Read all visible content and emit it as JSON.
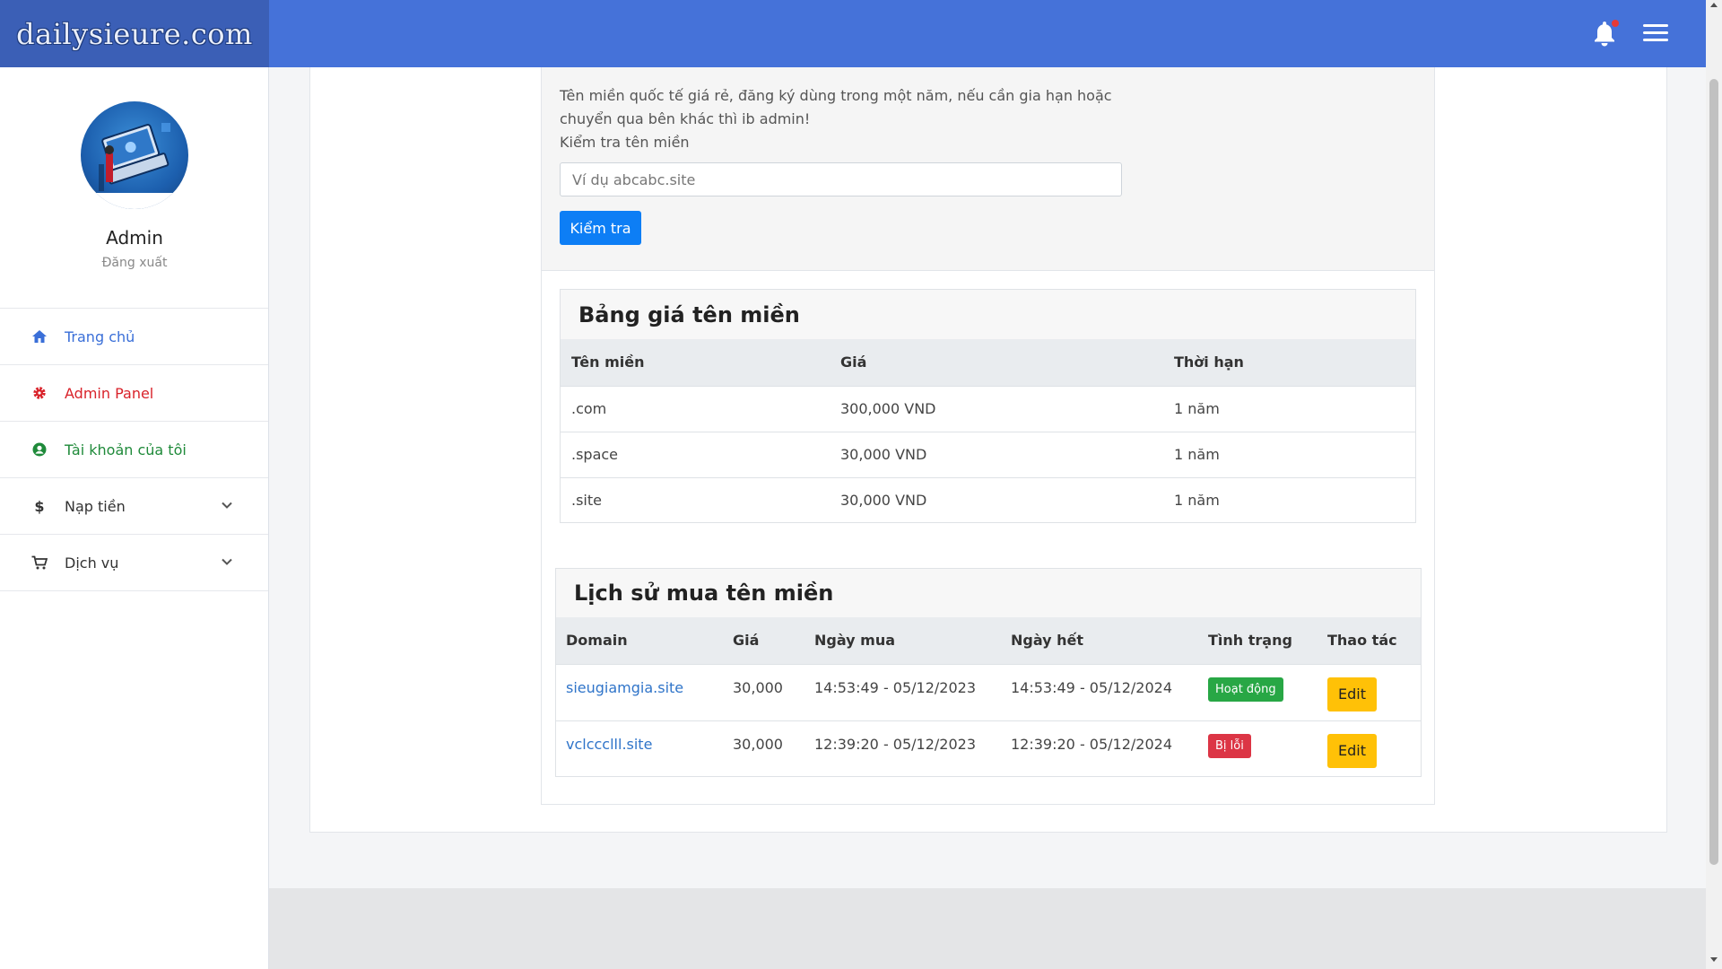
{
  "brand": {
    "name": "dailysieure.com"
  },
  "header": {
    "bell_icon": "bell-icon",
    "menu_icon": "hamburger-icon"
  },
  "profile": {
    "name": "Admin",
    "logout_label": "Đăng xuất"
  },
  "sidebar": {
    "items": [
      {
        "label": "Trang chủ",
        "icon": "home-icon",
        "color": "#3a6fd8"
      },
      {
        "label": "Admin Panel",
        "icon": "gear-icon",
        "color": "#d9222a"
      },
      {
        "label": "Tài khoản của tôi",
        "icon": "user-circle-icon",
        "color": "#1f8a3a"
      },
      {
        "label": "Nạp tiền",
        "icon": "dollar-icon",
        "color": "#333333"
      },
      {
        "label": "Dịch vụ",
        "icon": "cart-icon",
        "color": "#333333"
      }
    ]
  },
  "check": {
    "description": "Tên miền quốc tế giá rẻ, đăng ký dùng trong một năm, nếu cần gia hạn hoặc chuyển qua bên khác thì ib admin!",
    "label": "Kiểm tra tên miền",
    "placeholder": "Ví dụ abcabc.site",
    "button_label": "Kiểm tra"
  },
  "price_table": {
    "title": "Bảng giá tên miền",
    "headers": [
      "Tên miền",
      "Giá",
      "Thời hạn"
    ],
    "rows": [
      [
        ".com",
        "300,000 VND",
        "1 năm"
      ],
      [
        ".space",
        "30,000 VND",
        "1 năm"
      ],
      [
        ".site",
        "30,000 VND",
        "1 năm"
      ]
    ]
  },
  "history_table": {
    "title": "Lịch sử mua tên miền",
    "headers": [
      "Domain",
      "Giá",
      "Ngày mua",
      "Ngày hết",
      "Tình trạng",
      "Thao tác"
    ],
    "rows": [
      {
        "domain": "sieugiamgia.site",
        "price": "30,000",
        "bought": "14:53:49 - 05/12/2023",
        "expires": "14:53:49 - 05/12/2024",
        "status": "Hoạt động",
        "status_color": "#28a745",
        "action": "Edit"
      },
      {
        "domain": "vclccclll.site",
        "price": "30,000",
        "bought": "12:39:20 - 05/12/2023",
        "expires": "12:39:20 - 05/12/2024",
        "status": "Bị lỗi",
        "status_color": "#dc3545",
        "action": "Edit"
      }
    ]
  },
  "colors": {
    "topbar": "#4572d9",
    "brand_bg": "#3b5fb6",
    "primary_button": "#0d7ef5",
    "edit_button": "#ffc107"
  }
}
